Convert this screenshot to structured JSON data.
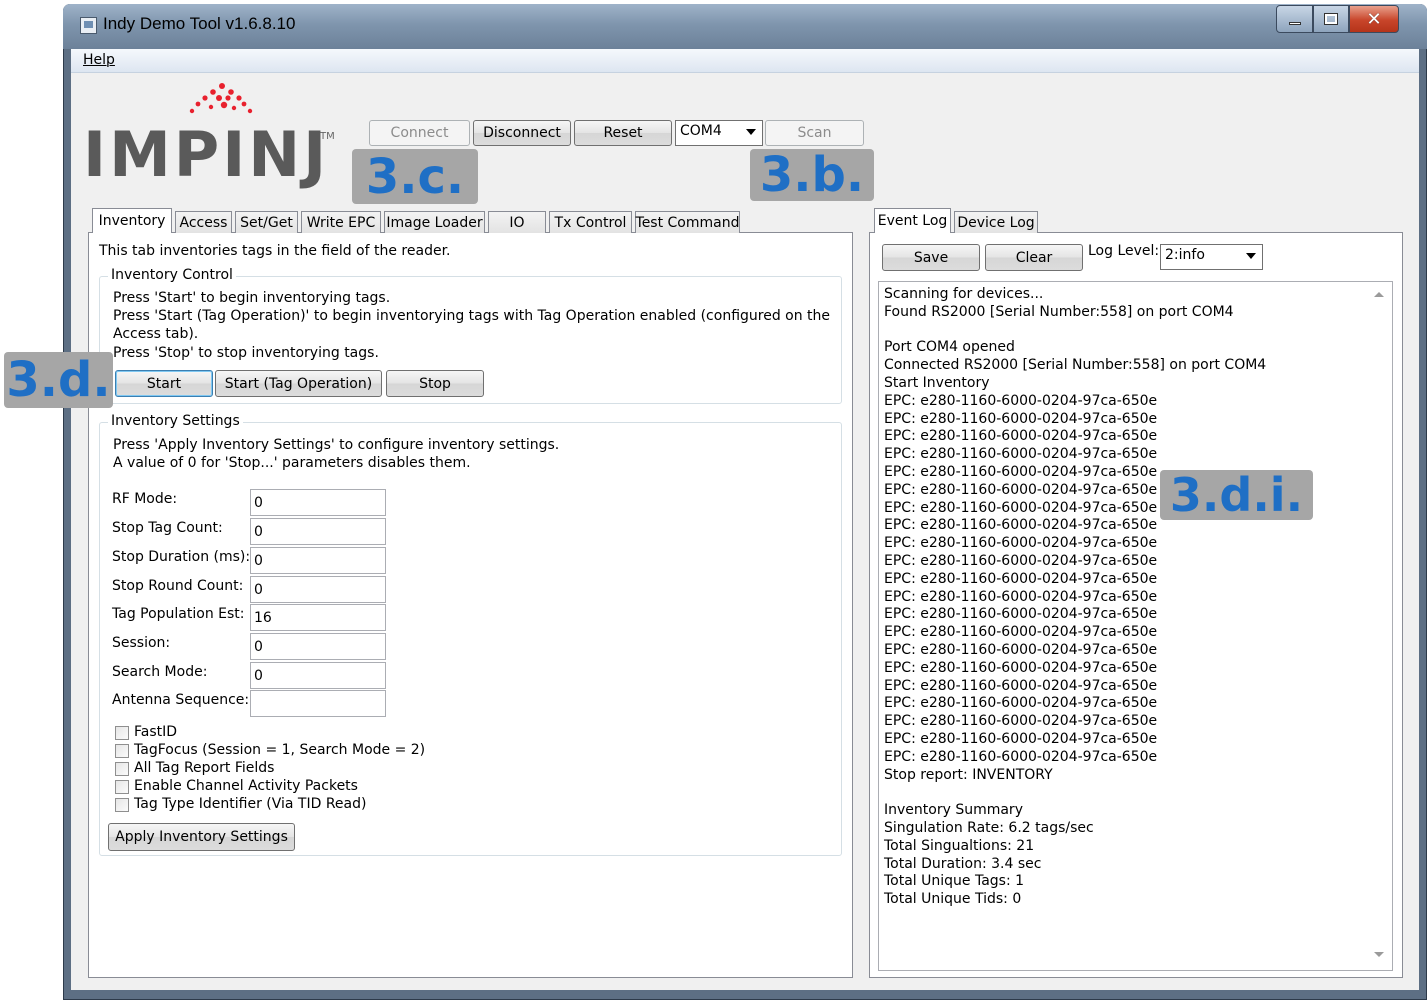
{
  "window": {
    "title": "Indy Demo Tool v1.6.8.10"
  },
  "menu": {
    "help": "Help"
  },
  "logo": {
    "wordmark": "IMPINJ",
    "tm": "TM"
  },
  "toolbar": {
    "connect": "Connect",
    "disconnect": "Disconnect",
    "reset": "Reset",
    "port": "COM4",
    "scan": "Scan"
  },
  "overlays": {
    "c": "3.c.",
    "b": "3.b.",
    "d": "3.d.",
    "di": "3.d.i."
  },
  "left_tabs": [
    "Inventory",
    "Access",
    "Set/Get",
    "Write EPC",
    "Image Loader",
    "IO",
    "Tx Control",
    "Test Command"
  ],
  "inventory": {
    "description": "This tab inventories tags in the field of the reader.",
    "control": {
      "title": "Inventory Control",
      "line1": "Press 'Start' to begin inventorying tags.",
      "line2": "Press 'Start (Tag Operation)' to begin inventorying tags with Tag Operation enabled (configured on the",
      "line3": "Access tab).",
      "line4": "Press 'Stop' to stop inventorying tags.",
      "start": "Start",
      "start_tag_op": "Start (Tag Operation)",
      "stop": "Stop"
    },
    "settings": {
      "title": "Inventory Settings",
      "line1": "Press 'Apply Inventory Settings' to configure inventory settings.",
      "line2": "A value of 0 for 'Stop...' parameters disables them.",
      "fields": [
        {
          "label": "RF Mode:",
          "value": "0"
        },
        {
          "label": "Stop Tag Count:",
          "value": "0"
        },
        {
          "label": "Stop Duration (ms):",
          "value": "0"
        },
        {
          "label": "Stop Round Count:",
          "value": "0"
        },
        {
          "label": "Tag Population Est:",
          "value": "16"
        },
        {
          "label": "Session:",
          "value": "0"
        },
        {
          "label": "Search Mode:",
          "value": "0"
        },
        {
          "label": "Antenna Sequence:",
          "value": ""
        }
      ],
      "checkboxes": [
        "FastID",
        "TagFocus (Session = 1, Search Mode = 2)",
        "All Tag Report Fields",
        "Enable Channel Activity Packets",
        "Tag Type Identifier (Via TID Read)"
      ],
      "apply": "Apply Inventory Settings"
    }
  },
  "right_tabs": [
    "Event Log",
    "Device Log"
  ],
  "eventlog": {
    "save": "Save",
    "clear": "Clear",
    "log_level_label": "Log Level:",
    "log_level": "2:info",
    "lines": [
      "Scanning for devices...",
      "Found RS2000 [Serial Number:558] on port COM4",
      "",
      "Port COM4 opened",
      "Connected RS2000 [Serial Number:558] on port COM4",
      "Start Inventory",
      "EPC: e280-1160-6000-0204-97ca-650e",
      "EPC: e280-1160-6000-0204-97ca-650e",
      "EPC: e280-1160-6000-0204-97ca-650e",
      "EPC: e280-1160-6000-0204-97ca-650e",
      "EPC: e280-1160-6000-0204-97ca-650e",
      "EPC: e280-1160-6000-0204-97ca-650e",
      "EPC: e280-1160-6000-0204-97ca-650e",
      "EPC: e280-1160-6000-0204-97ca-650e",
      "EPC: e280-1160-6000-0204-97ca-650e",
      "EPC: e280-1160-6000-0204-97ca-650e",
      "EPC: e280-1160-6000-0204-97ca-650e",
      "EPC: e280-1160-6000-0204-97ca-650e",
      "EPC: e280-1160-6000-0204-97ca-650e",
      "EPC: e280-1160-6000-0204-97ca-650e",
      "EPC: e280-1160-6000-0204-97ca-650e",
      "EPC: e280-1160-6000-0204-97ca-650e",
      "EPC: e280-1160-6000-0204-97ca-650e",
      "EPC: e280-1160-6000-0204-97ca-650e",
      "EPC: e280-1160-6000-0204-97ca-650e",
      "EPC: e280-1160-6000-0204-97ca-650e",
      "EPC: e280-1160-6000-0204-97ca-650e",
      "Stop report: INVENTORY",
      "",
      "Inventory Summary",
      "Singulation Rate: 6.2 tags/sec",
      "Total Singualtions: 21",
      "Total Duration: 3.4 sec",
      "Total Unique Tags: 1",
      "Total Unique Tids: 0"
    ]
  },
  "colors": {
    "overlay_text": "#1f6fc5",
    "overlay_bg": "#a6a6a6",
    "logo_dots": "#e8212e",
    "logo_text": "#5a5a5a"
  }
}
